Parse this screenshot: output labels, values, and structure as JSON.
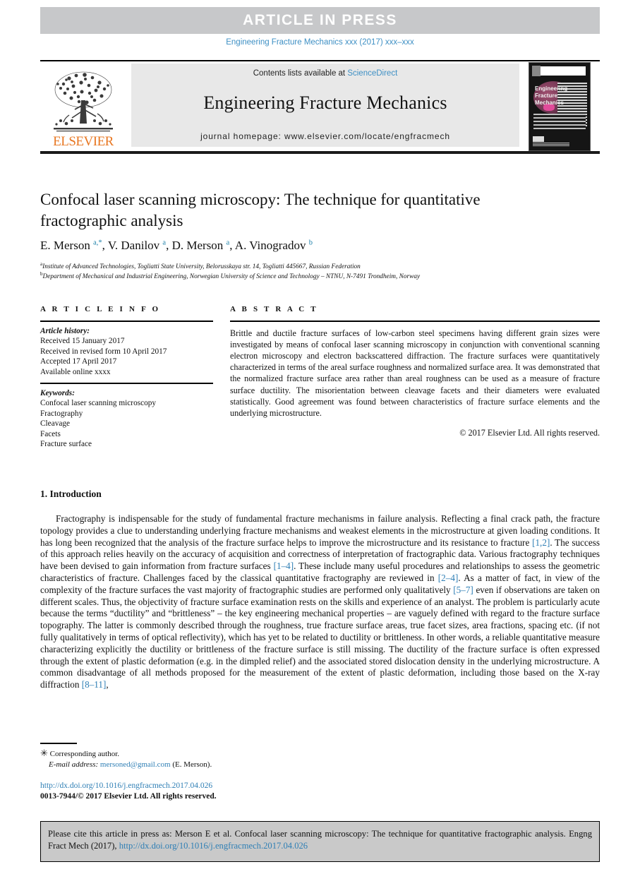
{
  "header": {
    "article_in_press": "ARTICLE  IN  PRESS",
    "journal_ref": "Engineering Fracture Mechanics xxx (2017) xxx–xxx"
  },
  "masthead": {
    "contents_prefix": "Contents lists available at ",
    "sciencedirect": "ScienceDirect",
    "journal_title": "Engineering Fracture Mechanics",
    "homepage": "journal homepage: www.elsevier.com/locate/engfracmech",
    "publisher_logo_text": "ELSEVIER",
    "cover_title": "Engineering Fracture Mechanics"
  },
  "article": {
    "title": "Confocal laser scanning microscopy: The technique for quantitative fractographic analysis",
    "authors_html": "E. Merson <sup>a,*</sup>, V. Danilov <sup>a</sup>, D. Merson <sup>a</sup>, A. Vinogradov <sup>b</sup>",
    "affiliation_a": "Institute of Advanced Technologies, Togliatti State University, Belorusskaya str. 14, Togliatti 445667, Russian Federation",
    "affiliation_b": "Department of Mechanical and Industrial Engineering, Norwegian University of Science and Technology – NTNU, N-7491 Trondheim, Norway"
  },
  "article_info": {
    "heading": "A R T I C L E  I N F O",
    "history_label": "Article history:",
    "history": [
      "Received 15 January 2017",
      "Received in revised form 10 April 2017",
      "Accepted 17 April 2017",
      "Available online xxxx"
    ],
    "keywords_label": "Keywords:",
    "keywords": [
      "Confocal laser scanning microscopy",
      "Fractography",
      "Cleavage",
      "Facets",
      "Fracture surface"
    ]
  },
  "abstract": {
    "heading": "A B S T R A C T",
    "body": "Brittle and ductile fracture surfaces of low-carbon steel specimens having different grain sizes were investigated by means of confocal laser scanning microscopy in conjunction with conventional scanning electron microscopy and electron backscattered diffraction. The fracture surfaces were quantitatively characterized in terms of the areal surface roughness and normalized surface area. It was demonstrated that the normalized fracture surface area rather than areal roughness can be used as a measure of fracture surface ductility. The misorientation between cleavage facets and their diameters were evaluated statistically. Good agreement was found between characteristics of fracture surface elements and the underlying microstructure.",
    "copyright": "© 2017 Elsevier Ltd. All rights reserved."
  },
  "introduction": {
    "heading": "1. Introduction",
    "paragraph_html": "Fractography is indispensable for the study of fundamental fracture mechanisms in failure analysis. Reflecting a final crack path, the fracture topology provides a clue to understanding underlying fracture mechanisms and weakest elements in the microstructure at given loading conditions. It has long been recognized that the analysis of the fracture surface helps to improve the microstructure and its resistance to fracture <span class=\"ref\">[1,2]</span>. The success of this approach relies heavily on the accuracy of acquisition and correctness of interpretation of fractographic data. Various fractography techniques have been devised to gain information from fracture surfaces <span class=\"ref\">[1–4]</span>. These include many useful procedures and relationships to assess the geometric characteristics of fracture. Challenges faced by the classical quantitative fractography are reviewed in <span class=\"ref\">[2–4]</span>. As a matter of fact, in view of the complexity of the fracture surfaces the vast majority of fractographic studies are performed only qualitatively <span class=\"ref\">[5–7]</span> even if observations are taken on different scales. Thus, the objectivity of fracture surface examination rests on the skills and experience of an analyst. The problem is particularly acute because the terms “ductility” and “brittleness” – the key engineering mechanical properties – are vaguely defined with regard to the fracture surface topography. The latter is commonly described through the roughness, true fracture surface areas, true facet sizes, area fractions, spacing etc. (if not fully qualitatively in terms of optical reflectivity), which has yet to be related to ductility or brittleness. In other words, a reliable quantitative measure characterizing explicitly the ductility or brittleness of the fracture surface is still missing. The ductility of the fracture surface is often expressed through the extent of plastic deformation (e.g. in the dimpled relief) and the associated stored dislocation density in the underlying microstructure. A common disadvantage of all methods proposed for the measurement of the extent of plastic deformation, including those based on the X-ray diffraction <span class=\"ref\">[8–11]</span>,"
  },
  "footnote": {
    "corresponding_html": "<span style=\"font-size:13px\">&#10035;</span> Corresponding author.",
    "email_html": "<span class=\"ital\">E-mail address:</span> <span class=\"link\">mersoned@gmail.com</span> (E. Merson).",
    "doi": "http://dx.doi.org/10.1016/j.engfracmech.2017.04.026",
    "issn": "0013-7944/© 2017 Elsevier Ltd. All rights reserved."
  },
  "cite_box": {
    "text_html": "Please cite this article in press as: Merson E et al. Confocal laser scanning microscopy: The technique for quantitative fractographic analysis. Engng Fract Mech (2017), <span class=\"link\">http://dx.doi.org/10.1016/j.engfracmech.2017.04.026</span>"
  },
  "colors": {
    "band_gray": "#c7c8ca",
    "masthead_gray": "#e8e8e8",
    "link_blue": "#3d8fc4",
    "ref_blue": "#2f7fb5",
    "elsevier_orange": "#e87722",
    "cite_box_gray": "#c9c9c9"
  }
}
